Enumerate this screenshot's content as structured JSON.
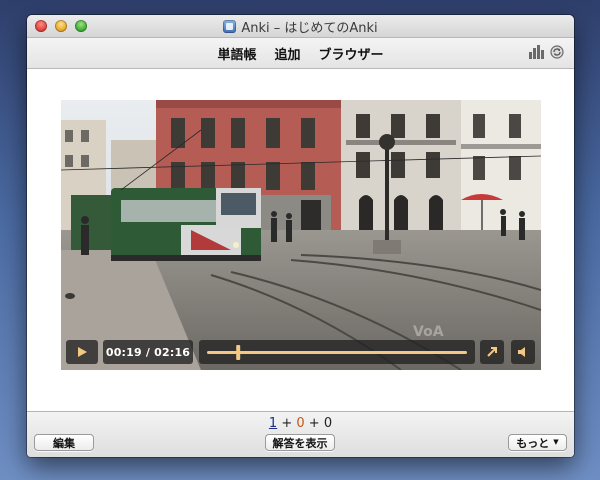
{
  "window": {
    "title": "Anki – はじめてのAnki"
  },
  "toolbar": {
    "links": [
      "単語帳",
      "追加",
      "ブラウザー"
    ]
  },
  "video": {
    "time_display": "00:19 / 02:16",
    "progress": 0.12,
    "accent_color": "#f2c884"
  },
  "review": {
    "new_count": "1",
    "learn_count": "0",
    "review_count": "0",
    "plus": "+"
  },
  "buttons": {
    "edit": "編集",
    "show_answer": "解答を表示",
    "more": "もっと"
  }
}
